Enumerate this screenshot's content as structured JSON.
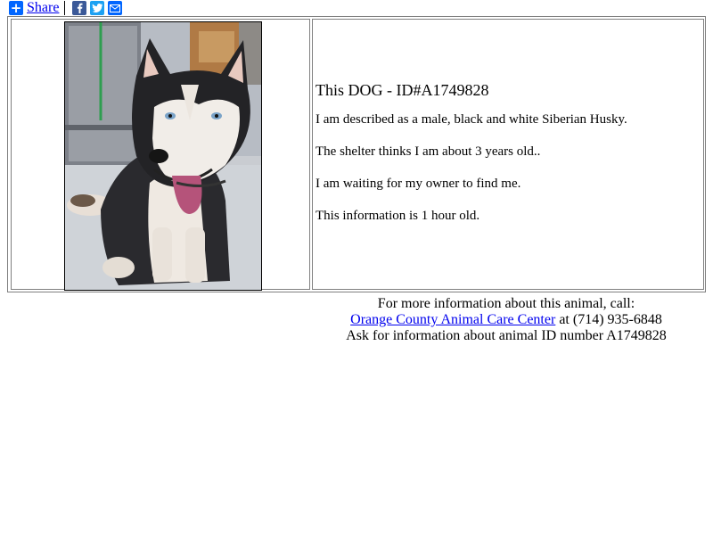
{
  "share": {
    "label": "Share",
    "icons": [
      "plus-icon",
      "facebook-icon",
      "twitter-icon",
      "email-icon"
    ],
    "colors": {
      "plus": "#0166ff",
      "facebook": "#3b5998",
      "twitter": "#1da1f2",
      "email": "#0166ff"
    }
  },
  "animal": {
    "title": "This DOG - ID#A1749828",
    "lines": [
      "I am described as a male, black and white Siberian Husky.",
      "The shelter thinks I am about 3 years old..",
      "I am waiting for my owner to find me.",
      "This information is 1 hour old."
    ]
  },
  "footer": {
    "line1": "For more information about this animal, call:",
    "shelter_name": "Orange County Animal Care Center",
    "phone_text": " at (714) 935-6848",
    "line3": "Ask for information about animal ID number A1749828"
  },
  "colors": {
    "link": "#0000ee",
    "border": "#808080"
  }
}
